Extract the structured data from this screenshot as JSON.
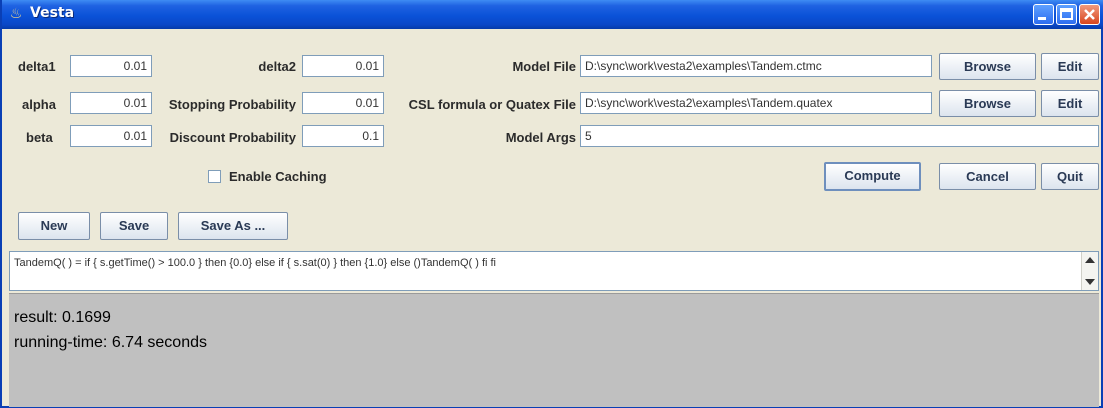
{
  "window": {
    "title": "Vesta"
  },
  "params": {
    "delta1": {
      "label": "delta1",
      "value": "0.01"
    },
    "alpha": {
      "label": "alpha",
      "value": "0.01"
    },
    "beta": {
      "label": "beta",
      "value": "0.01"
    },
    "delta2": {
      "label": "delta2",
      "value": "0.01"
    },
    "stopping": {
      "label": "Stopping Probability",
      "value": "0.01"
    },
    "discount": {
      "label": "Discount Probability",
      "value": "0.1"
    }
  },
  "files": {
    "model_label": "Model File",
    "model_value": "D:\\sync\\work\\vesta2\\examples\\Tandem.ctmc",
    "formula_label": "CSL formula or Quatex File",
    "formula_value": "D:\\sync\\work\\vesta2\\examples\\Tandem.quatex",
    "args_label": "Model Args",
    "args_value": "5"
  },
  "buttons": {
    "browse": "Browse",
    "edit": "Edit",
    "compute": "Compute",
    "cancel": "Cancel",
    "quit": "Quit",
    "new": "New",
    "save": "Save",
    "save_as": "Save As ..."
  },
  "caching": {
    "label": "Enable Caching",
    "checked": false
  },
  "editor": {
    "text": "TandemQ( ) = if { s.getTime() > 100.0 } then {0.0} else if { s.sat(0) } then {1.0} else ()TandemQ( ) fi fi"
  },
  "output": {
    "result": "result: 0.1699",
    "time": "running-time: 6.74 seconds"
  },
  "colors": {
    "titlebar": "#0a52d8",
    "output_bg": "#c0c0c0",
    "window_bg": "#ece9d8"
  },
  "icons": [
    "java-cup-icon",
    "minimize-icon",
    "maximize-icon",
    "close-icon"
  ]
}
